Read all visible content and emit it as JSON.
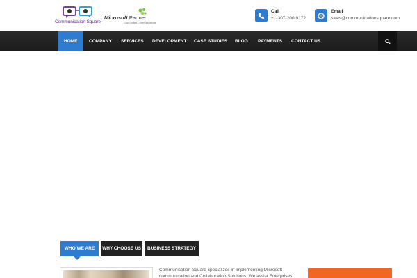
{
  "header": {
    "logo_text": "Communication Square",
    "partner": {
      "brand": "Microsoft",
      "word": " Partner",
      "sub": "Gold Unified Communications"
    },
    "contacts": [
      {
        "title": "Call",
        "value": "+1-307-200-9172",
        "icon": "phone-icon"
      },
      {
        "title": "Email",
        "value": "sales@communicationsquare.com",
        "icon": "at-icon"
      }
    ]
  },
  "nav": {
    "items": [
      {
        "label": "HOME",
        "active": true
      },
      {
        "label": "COMPANY",
        "active": false
      },
      {
        "label": "SERVICES",
        "active": false
      },
      {
        "label": "DEVELOPMENT",
        "active": false
      },
      {
        "label": "CASE STUDIES",
        "active": false
      },
      {
        "label": "BLOG",
        "active": false
      },
      {
        "label": "PAYMENTS",
        "active": false
      },
      {
        "label": "CONTACT US",
        "active": false
      }
    ],
    "search_icon": "search-icon"
  },
  "tabs": [
    {
      "label": "WHO WE ARE",
      "active": true
    },
    {
      "label": "WHY CHOOSE US",
      "active": false
    },
    {
      "label": "BUSINESS STRATEGY",
      "active": false
    }
  ],
  "content": {
    "description": "Communication Square specializes in implementing Microsoft communication and Collaboration Solutions. We assist Enterprises, ranging"
  },
  "colors": {
    "accent": "#2f7bd0",
    "nav_bg": "#222222",
    "cta": "#f26522"
  }
}
